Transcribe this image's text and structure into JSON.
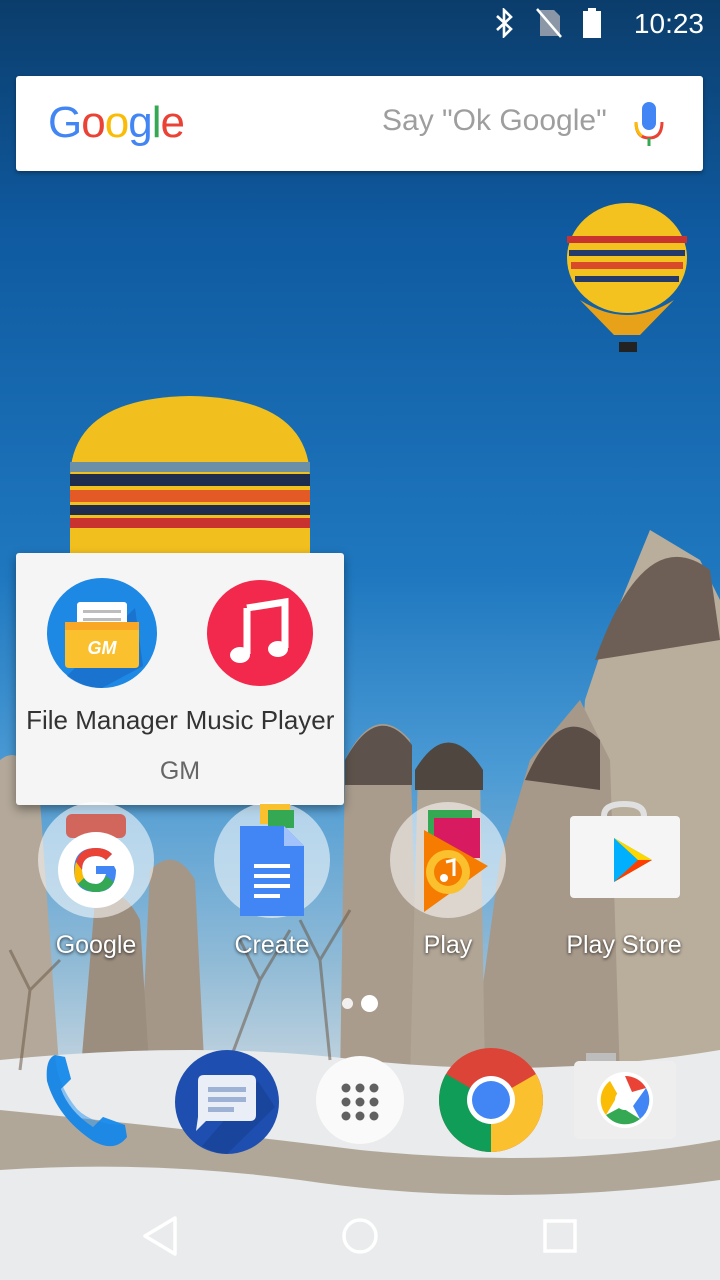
{
  "status": {
    "time": "10:23",
    "icons": [
      "bluetooth-icon",
      "no-sim-icon",
      "battery-icon"
    ]
  },
  "search": {
    "logo": "Google",
    "hint": "Say \"Ok Google\""
  },
  "folder": {
    "name": "GM",
    "apps": [
      {
        "label": "File Manager",
        "icon": "file-manager-icon"
      },
      {
        "label": "Music Player",
        "icon": "music-player-icon"
      }
    ]
  },
  "home_apps": [
    {
      "label": "Google",
      "icon": "google-folder-icon"
    },
    {
      "label": "Create",
      "icon": "create-folder-icon"
    },
    {
      "label": "Play",
      "icon": "play-folder-icon"
    },
    {
      "label": "Play Store",
      "icon": "play-store-icon"
    }
  ],
  "page_indicator": {
    "pages": 2,
    "current": 2
  },
  "dock": [
    "phone-icon",
    "messages-icon",
    "app-drawer-icon",
    "chrome-icon",
    "camera-icon"
  ],
  "nav": [
    "back-icon",
    "home-icon",
    "recents-icon"
  ]
}
